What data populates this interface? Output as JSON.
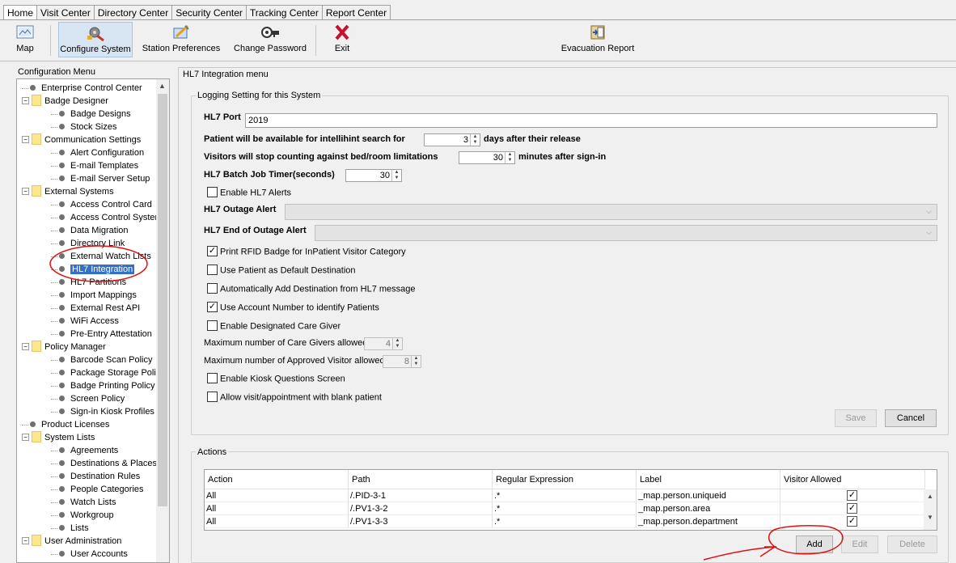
{
  "tabs": [
    "Home",
    "Visit Center",
    "Directory Center",
    "Security Center",
    "Tracking Center",
    "Report Center"
  ],
  "toolbar": {
    "map": "Map",
    "configure": "Configure System",
    "station": "Station Preferences",
    "password": "Change Password",
    "exit": "Exit",
    "evacuation": "Evacuation Report"
  },
  "tree": {
    "header": "Configuration Menu",
    "items": [
      "Enterprise Control Center",
      "Badge Designer",
      "Badge Designs",
      "Stock Sizes",
      "Communication Settings",
      "Alert Configuration",
      "E-mail Templates",
      "E-mail Server Setup",
      "External Systems",
      "Access Control Card",
      "Access Control Systems",
      "Data Migration",
      "Directory Link",
      "External Watch Lists",
      "HL7 Integration",
      "HL7 Partitions",
      "Import Mappings",
      "External Rest API",
      "WiFi Access",
      "Pre-Entry Attestation",
      "Policy Manager",
      "Barcode Scan Policy",
      "Package Storage Policy",
      "Badge Printing Policy",
      "Screen Policy",
      "Sign-in Kiosk Profiles",
      "Product Licenses",
      "System Lists",
      "Agreements",
      "Destinations & Places",
      "Destination Rules",
      "People Categories",
      "Watch Lists",
      "Workgroup",
      "Lists",
      "User Administration",
      "User Accounts"
    ]
  },
  "main": {
    "title": "HL7 Integration menu",
    "logging_group": "Logging Setting for this System",
    "hl7_port_label": "HL7 Port",
    "hl7_port_value": "2019",
    "patient_search_label": "Patient will be available for intellihint search for",
    "patient_search_value": "3",
    "patient_search_suffix": "days after their release",
    "visitors_label": "Visitors will stop counting against bed/room limitations",
    "visitors_value": "30",
    "visitors_suffix": "minutes after sign-in",
    "batch_label": "HL7 Batch Job Timer(seconds)",
    "batch_value": "30",
    "enable_alerts": "Enable HL7 Alerts",
    "outage_alert": "HL7 Outage Alert",
    "end_outage_alert": "HL7 End of Outage Alert",
    "print_rfid": "Print RFID Badge for InPatient Visitor Category",
    "use_patient_default": "Use Patient as Default Destination",
    "auto_add_dest": "Automatically Add Destination from HL7 message",
    "use_account_number": "Use Account Number to identify Patients",
    "enable_care_giver": "Enable Designated Care Giver",
    "max_care_givers_label": "Maximum number of Care Givers allowed",
    "max_care_givers_value": "4",
    "max_approved_label": "Maximum number of Approved Visitor allowed",
    "max_approved_value": "8",
    "enable_kiosk": "Enable Kiosk Questions Screen",
    "allow_blank_patient": "Allow visit/appointment with blank patient",
    "save": "Save",
    "cancel": "Cancel"
  },
  "actions": {
    "group": "Actions",
    "columns": [
      "Action",
      "Path",
      "Regular Expression",
      "Label",
      "Visitor Allowed"
    ],
    "rows": [
      {
        "action": "All",
        "path": "/.PID-3-1",
        "regex": ".*",
        "label": "_map.person.uniqueid",
        "allowed": true
      },
      {
        "action": "All",
        "path": "/.PV1-3-2",
        "regex": ".*",
        "label": "_map.person.area",
        "allowed": true
      },
      {
        "action": "All",
        "path": "/.PV1-3-3",
        "regex": ".*",
        "label": "_map.person.department",
        "allowed": true
      }
    ],
    "add": "Add",
    "edit": "Edit",
    "delete": "Delete"
  }
}
